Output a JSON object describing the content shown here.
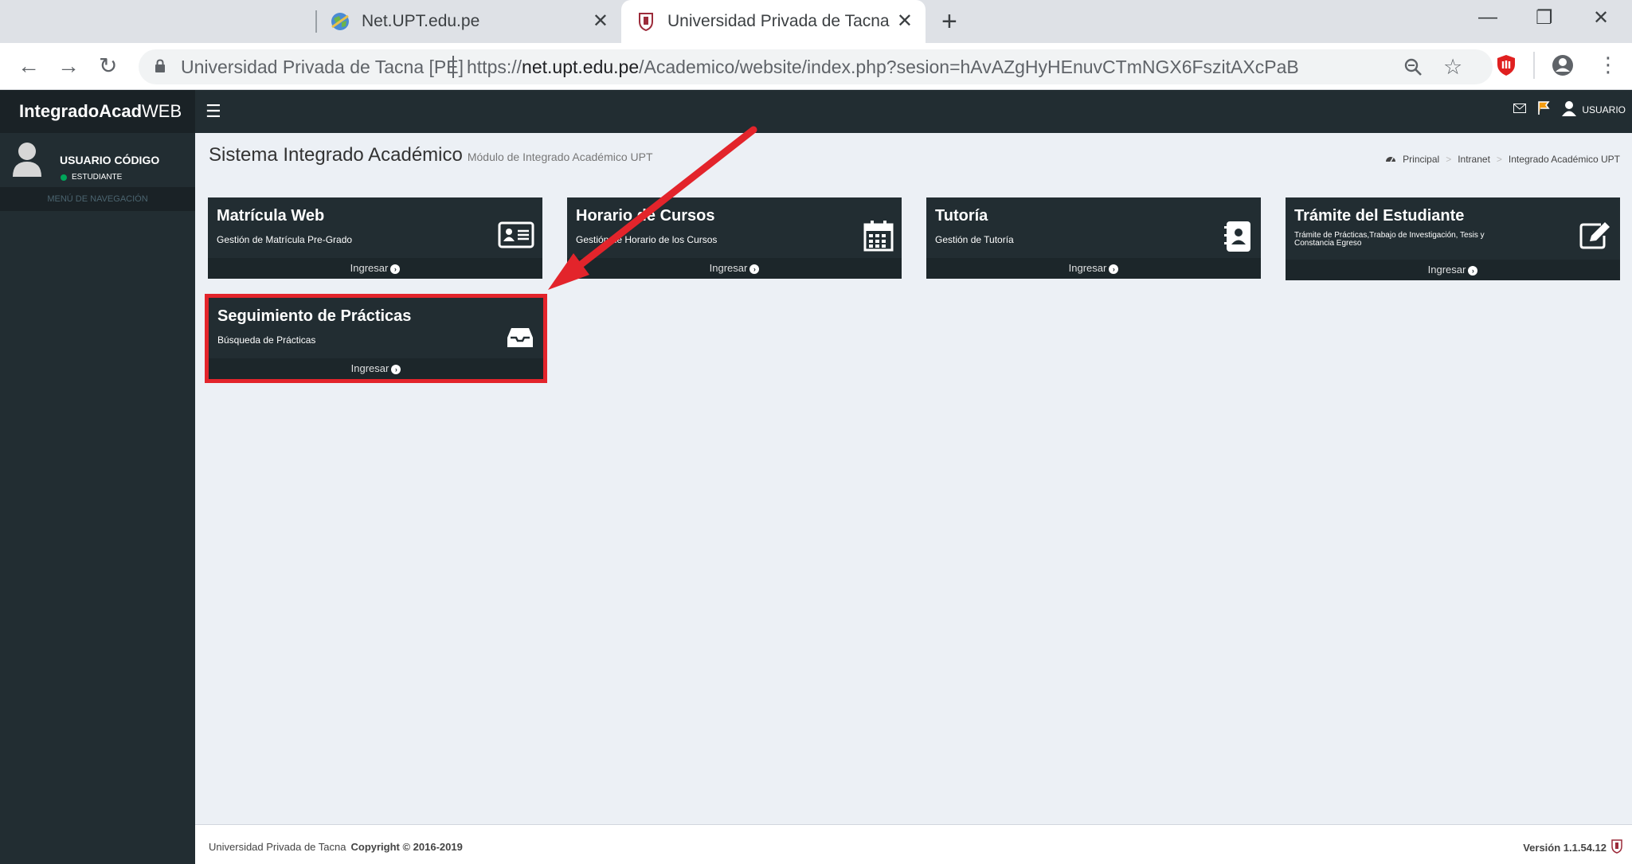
{
  "browser": {
    "tabs": [
      {
        "title": "Net.UPT.edu.pe",
        "active": false
      },
      {
        "title": "Universidad Privada de Tacna",
        "active": true
      }
    ],
    "address": {
      "site_label": "Universidad Privada de Tacna [PE]",
      "url_scheme": "https://",
      "url_host": "net.upt.edu.pe",
      "url_path": "/Academico/website/index.php?sesion=hAvAZgHyHEnuvCTmNGX6FszitAXcPaB"
    }
  },
  "app": {
    "logo_bold": "IntegradoAcad",
    "logo_light": "WEB",
    "header_user": "USUARIO"
  },
  "sidebar": {
    "user_name": "USUARIO CÓDIGO",
    "user_role": "ESTUDIANTE",
    "nav_header": "MENÚ DE NAVEGACIÓN"
  },
  "page": {
    "title": "Sistema Integrado Académico",
    "subtitle": "Módulo de Integrado Académico UPT",
    "breadcrumb": [
      "Principal",
      "Intranet",
      "Integrado Académico UPT"
    ]
  },
  "cards": [
    {
      "title": "Matrícula Web",
      "subtitle": "Gestión de Matrícula Pre-Grado",
      "link": "Ingresar",
      "icon": "id-card-icon"
    },
    {
      "title": "Horario de Cursos",
      "subtitle": "Gestión de Horario de los Cursos",
      "link": "Ingresar",
      "icon": "calendar-icon"
    },
    {
      "title": "Tutoría",
      "subtitle": "Gestión de Tutoría",
      "link": "Ingresar",
      "icon": "contact-book-icon"
    },
    {
      "title": "Trámite del Estudiante",
      "subtitle": "Trámite de Prácticas,Trabajo de Investigación, Tesis y Constancia Egreso",
      "link": "Ingresar",
      "icon": "edit-icon"
    },
    {
      "title": "Seguimiento de Prácticas",
      "subtitle": "Búsqueda de Prácticas",
      "link": "Ingresar",
      "icon": "inbox-icon"
    }
  ],
  "footer": {
    "org": "Universidad Privada de Tacna",
    "copyright": "Copyright © 2016-2019",
    "version": "Versión 1.1.54.12"
  },
  "colors": {
    "sidebar": "#222d32",
    "content_bg": "#ecf0f5",
    "highlight": "#e3242b"
  }
}
